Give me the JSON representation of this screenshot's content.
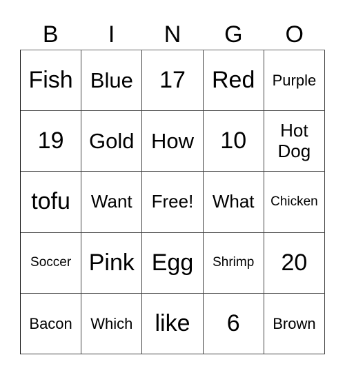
{
  "header": [
    "B",
    "I",
    "N",
    "G",
    "O"
  ],
  "rows": [
    [
      {
        "text": "Fish",
        "size": "xl"
      },
      {
        "text": "Blue",
        "size": "lg"
      },
      {
        "text": "17",
        "size": "xl"
      },
      {
        "text": "Red",
        "size": "xl"
      },
      {
        "text": "Purple",
        "size": "sm"
      }
    ],
    [
      {
        "text": "19",
        "size": "xl"
      },
      {
        "text": "Gold",
        "size": "lg"
      },
      {
        "text": "How",
        "size": "lg"
      },
      {
        "text": "10",
        "size": "xl"
      },
      {
        "text": "Hot Dog",
        "size": "md"
      }
    ],
    [
      {
        "text": "tofu",
        "size": "xl"
      },
      {
        "text": "Want",
        "size": "md"
      },
      {
        "text": "Free!",
        "size": "md"
      },
      {
        "text": "What",
        "size": "md"
      },
      {
        "text": "Chicken",
        "size": "xs"
      }
    ],
    [
      {
        "text": "Soccer",
        "size": "xs"
      },
      {
        "text": "Pink",
        "size": "xl"
      },
      {
        "text": "Egg",
        "size": "xl"
      },
      {
        "text": "Shrimp",
        "size": "xs"
      },
      {
        "text": "20",
        "size": "xl"
      }
    ],
    [
      {
        "text": "Bacon",
        "size": "sm"
      },
      {
        "text": "Which",
        "size": "sm"
      },
      {
        "text": "like",
        "size": "xl"
      },
      {
        "text": "6",
        "size": "xl"
      },
      {
        "text": "Brown",
        "size": "sm"
      }
    ]
  ]
}
